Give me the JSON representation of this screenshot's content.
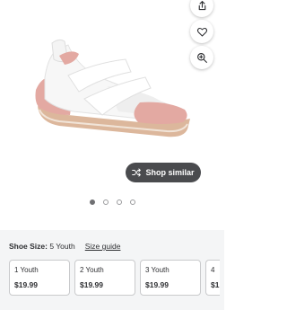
{
  "actions": {
    "share_icon": "share-icon",
    "favorite_icon": "heart-icon",
    "zoom_icon": "zoom-in-icon"
  },
  "shop_similar": {
    "label": "Shop similar",
    "icon": "shuffle-icon"
  },
  "carousel": {
    "count": 4,
    "active_index": 0
  },
  "size_selector": {
    "label": "Shoe Size:",
    "selected": "5 Youth",
    "guide_link": "Size guide",
    "options": [
      {
        "name": "1 Youth",
        "price": "$19.99"
      },
      {
        "name": "2 Youth",
        "price": "$19.99"
      },
      {
        "name": "3 Youth",
        "price": "$19.99"
      },
      {
        "name": "4",
        "price": "$1"
      }
    ]
  },
  "colors": {
    "shoe_pink": "#e2a6a0",
    "sole": "#d9b69b",
    "button_bg": "#4a4b4e"
  }
}
